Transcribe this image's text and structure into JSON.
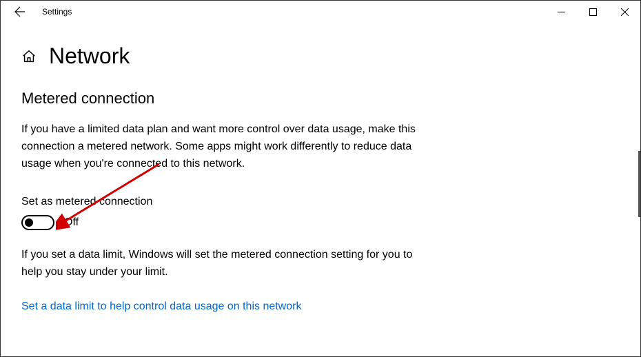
{
  "titlebar": {
    "title": "Settings"
  },
  "header": {
    "page_title": "Network"
  },
  "section": {
    "title": "Metered connection",
    "description": "If you have a limited data plan and want more control over data usage, make this connection a metered network. Some apps might work differently to reduce data usage when you're connected to this network.",
    "toggle_label": "Set as metered connection",
    "toggle_state": "Off",
    "note": "If you set a data limit, Windows will set the metered connection setting for you to help you stay under your limit.",
    "link": "Set a data limit to help control data usage on this network"
  }
}
